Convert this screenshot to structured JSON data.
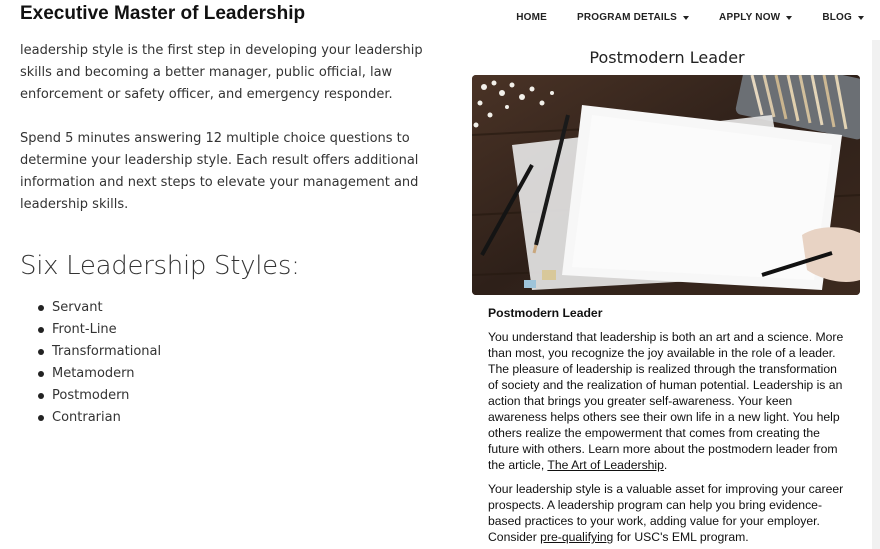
{
  "header": {
    "brand": "Executive Master of Leadership",
    "nav": [
      {
        "label": "HOME",
        "dropdown": false
      },
      {
        "label": "PROGRAM DETAILS",
        "dropdown": true
      },
      {
        "label": "APPLY NOW",
        "dropdown": true
      },
      {
        "label": "BLOG",
        "dropdown": true
      }
    ]
  },
  "intro": {
    "p1": "leadership style is the first step in developing your leadership skills and becoming a better manager, public official, law enforcement or safety officer, and emergency responder.",
    "p2": "Spend 5 minutes answering 12 multiple choice questions to determine your leadership style. Each result offers additional information and next steps to elevate your management and leadership skills."
  },
  "styles": {
    "heading": "Six Leadership Styles:",
    "items": [
      "Servant",
      "Front-Line",
      "Transformational",
      "Metamodern",
      "Postmodern",
      "Contrarian"
    ]
  },
  "result": {
    "title": "Postmodern Leader",
    "heading": "Postmodern Leader",
    "p1_text": "You understand that leadership is both an art and a science. More than most, you recognize the joy available in the role of a leader. The pleasure of leadership is realized through the transformation of society and the realization of human potential. Leadership is an action that brings you greater self-awareness. Your keen awareness helps others see their own life in a new light. You help others realize the empowerment that comes from creating the future with others. Learn more about the postmodern leader from the article, ",
    "p1_link": "The Art of Leadership",
    "p1_end": ".",
    "p2_text": "Your leadership style is a valuable asset for improving your career prospects. A leadership program can help you bring evidence-based practices to your work, adding value for your employer. Consider ",
    "p2_link": "pre-qualifying",
    "p2_end": " for USC's EML program."
  },
  "colors": {
    "text": "#333333",
    "photo_wood": "#3b2a20",
    "paper": "#f4f4f4"
  }
}
